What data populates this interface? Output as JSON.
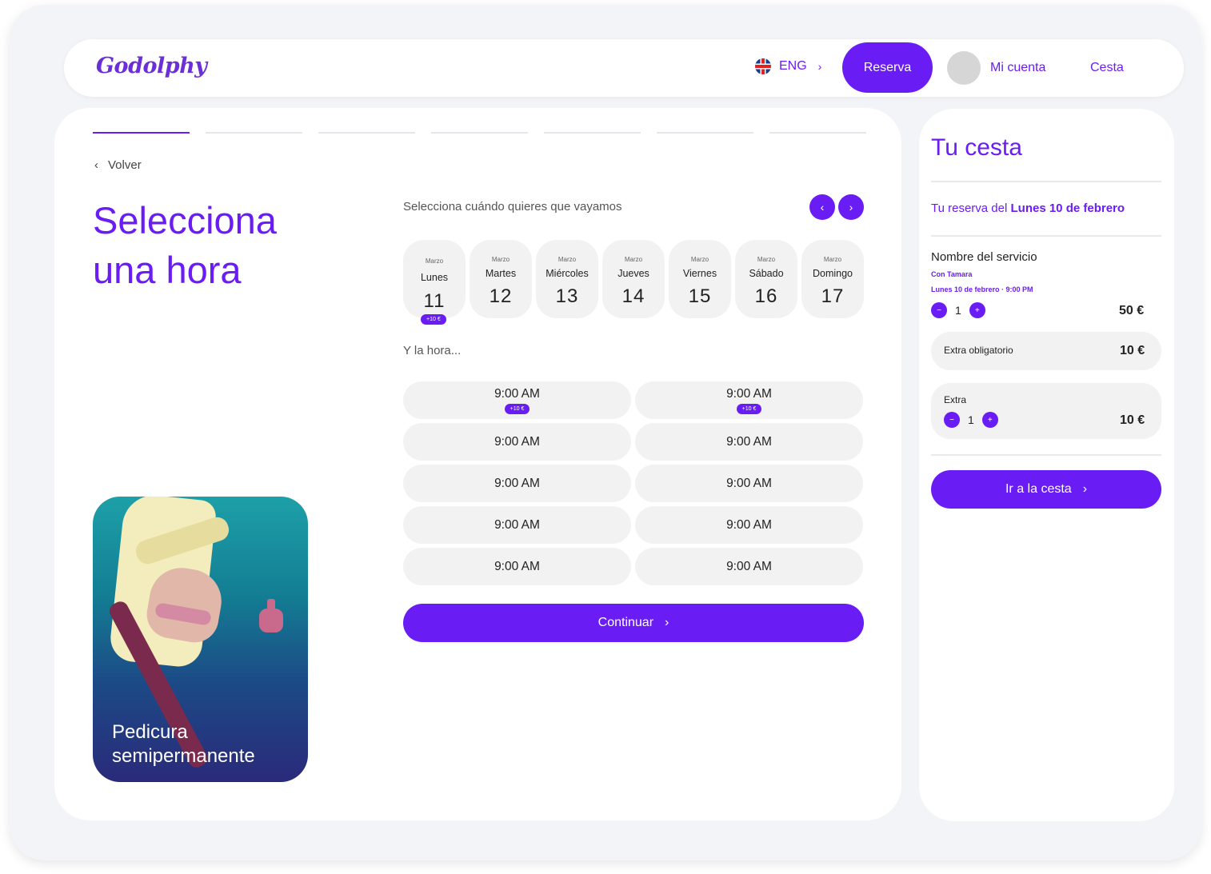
{
  "header": {
    "logo": "Godolphy",
    "language": "ENG",
    "reserva_label": "Reserva",
    "account_label": "Mi cuenta",
    "cart_label": "Cesta"
  },
  "booking": {
    "back_label": "Volver",
    "title": "Selecciona una hora",
    "when_label": "Selecciona cuándo quieres que vayamos",
    "time_label": "Y la hora...",
    "continue_label": "Continuar",
    "steps_total": 7,
    "steps_active": 1,
    "promo_label": "Pedicura semipermanente",
    "days": [
      {
        "month": "Marzo",
        "name": "Lunes",
        "num": "11",
        "badge": "+10 €",
        "selected": true
      },
      {
        "month": "Marzo",
        "name": "Martes",
        "num": "12"
      },
      {
        "month": "Marzo",
        "name": "Miércoles",
        "num": "13"
      },
      {
        "month": "Marzo",
        "name": "Jueves",
        "num": "14"
      },
      {
        "month": "Marzo",
        "name": "Viernes",
        "num": "15"
      },
      {
        "month": "Marzo",
        "name": "Sábado",
        "num": "16"
      },
      {
        "month": "Marzo",
        "name": "Domingo",
        "num": "17"
      }
    ],
    "slots": [
      {
        "time": "9:00 AM",
        "badge": "+10 €"
      },
      {
        "time": "9:00 AM",
        "badge": "+10 €"
      },
      {
        "time": "9:00 AM"
      },
      {
        "time": "9:00 AM"
      },
      {
        "time": "9:00 AM"
      },
      {
        "time": "9:00 AM"
      },
      {
        "time": "9:00 AM"
      },
      {
        "time": "9:00 AM"
      },
      {
        "time": "9:00 AM"
      },
      {
        "time": "9:00 AM"
      }
    ]
  },
  "cart": {
    "title": "Tu cesta",
    "reserva_prefix": "Tu reserva del ",
    "reserva_date": "Lunes 10 de febrero",
    "service_name": "Nombre del servicio",
    "service_with": "Con Tamara",
    "service_datetime": "Lunes 10 de febrero · 9:00 PM",
    "service_qty": "1",
    "service_price": "50 €",
    "extra_mandatory_label": "Extra obligatorio",
    "extra_mandatory_price": "10 €",
    "extra_label": "Extra",
    "extra_qty": "1",
    "extra_price": "10 €",
    "go_to_cart_label": "Ir a la cesta"
  },
  "colors": {
    "accent": "#6a1cf5",
    "surface": "#f2f2f3",
    "background": "#f3f4f8"
  }
}
